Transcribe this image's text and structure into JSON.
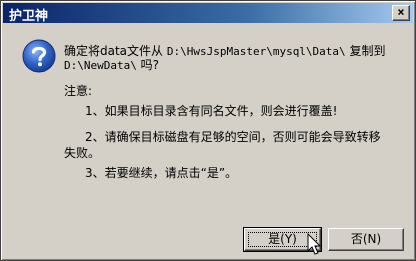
{
  "window": {
    "title": "护卫神",
    "close_glyph": "×"
  },
  "dialog": {
    "icon": "question-icon",
    "message_line1_prefix": "确定将data文件从 ",
    "message_path_src": "D:\\HwsJspMaster\\mysql\\Data\\",
    "message_line1_suffix": " 复制到",
    "message_path_dst": "D:\\NewData\\",
    "message_line2_suffix": " 吗?",
    "notice_heading": "注意:",
    "notes": [
      "1、如果目标目录含有同名文件，则会进行覆盖!",
      "2、请确保目标磁盘有足够的空间，否则可能会导致转移",
      "失败。",
      "3、若要继续，请点击“是”。"
    ]
  },
  "buttons": {
    "yes_label": "是(Y)",
    "no_label": "否(N)"
  },
  "colors": {
    "title_start": "#0a246a",
    "title_end": "#a6caf0",
    "icon_blue": "#2f63c8"
  }
}
